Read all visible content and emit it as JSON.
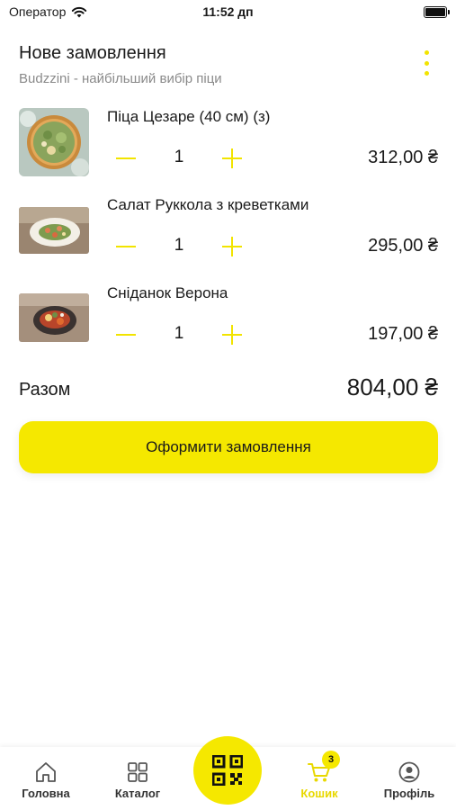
{
  "status": {
    "carrier": "Оператор",
    "time": "11:52 дп"
  },
  "header": {
    "title": "Нове замовлення",
    "subtitle": "Budzzini - найбільший вибір піци"
  },
  "items": [
    {
      "name": "Піца Цезаре (40 см) (з)",
      "quantity": "1",
      "price": "312,00 ₴"
    },
    {
      "name": "Салат Руккола з креветками",
      "quantity": "1",
      "price": "295,00 ₴"
    },
    {
      "name": "Сніданок Верона",
      "quantity": "1",
      "price": "197,00 ₴"
    }
  ],
  "total": {
    "label": "Разом",
    "value": "804,00 ₴"
  },
  "checkout": {
    "label": "Оформити замовлення"
  },
  "tabbar": {
    "home": "Головна",
    "catalog": "Каталог",
    "cart": "Кошик",
    "cart_badge": "3",
    "profile": "Профіль"
  },
  "colors": {
    "accent": "#f5e800",
    "text": "#1a1a1a",
    "muted": "#8a8a8a"
  },
  "icons": [
    "wifi-icon",
    "battery-icon",
    "more-vertical-icon",
    "minus-icon",
    "plus-icon",
    "home-icon",
    "grid-icon",
    "qr-code-icon",
    "cart-icon",
    "user-icon"
  ]
}
